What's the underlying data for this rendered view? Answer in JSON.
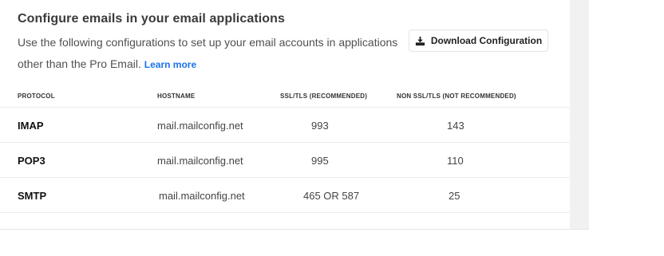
{
  "section": {
    "title": "Configure emails in your email applications",
    "description": "Use the following configurations to set up your email accounts in applications other than the Pro Email.",
    "learn_more": "Learn more",
    "download_button": "Download Configuration"
  },
  "table": {
    "headers": {
      "protocol": "PROTOCOL",
      "hostname": "HOSTNAME",
      "ssl": "SSL/TLS (RECOMMENDED)",
      "non_ssl": "NON SSL/TLS (NOT RECOMMENDED)"
    },
    "rows": [
      {
        "protocol": "IMAP",
        "hostname": "mail.mailconfig.net",
        "ssl": "993",
        "non_ssl": "143"
      },
      {
        "protocol": "POP3",
        "hostname": "mail.mailconfig.net",
        "ssl": "995",
        "non_ssl": "110"
      },
      {
        "protocol": "SMTP",
        "hostname": "mail.mailconfig.net",
        "ssl": "465 OR 587",
        "non_ssl": "25"
      }
    ]
  },
  "icons": {
    "download": "download-icon"
  }
}
